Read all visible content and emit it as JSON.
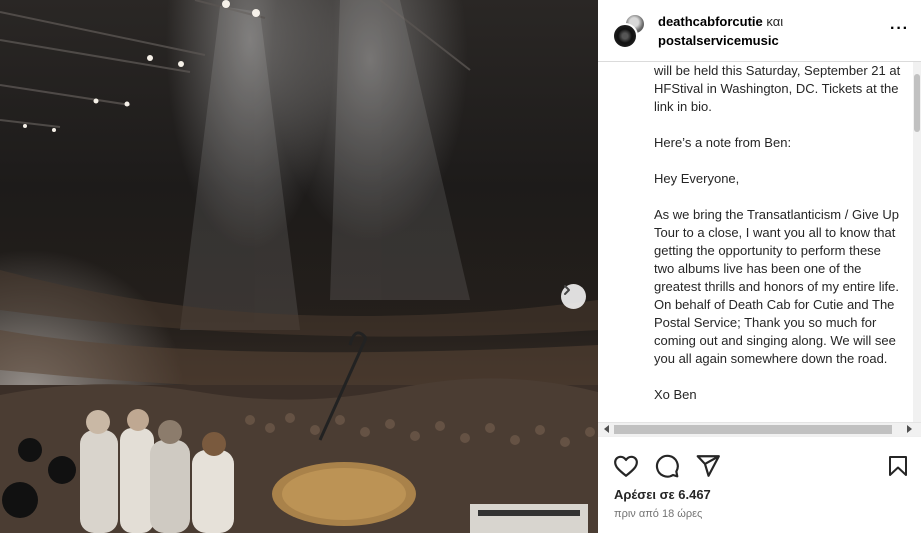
{
  "post": {
    "author_primary": "deathcabforcutie",
    "author_conjunction": "και",
    "author_secondary": "postalservicemusic",
    "caption_paragraphs": [
      "will be held this Saturday, September 21 at HFStival in Washington, DC. Tickets at the link in bio.",
      "Here’s a note from Ben:",
      "Hey Everyone,",
      "As we bring the Transatlanticism / Give Up Tour to a close, I want you all to know that getting the opportunity to perform these two albums live has been one of the greatest thrills and honors of my entire life. On behalf of Death Cab for Cutie and The Postal Service; Thank you so much for coming out and singing along. We will see you all again somewhere down the road.",
      "Xo Ben"
    ],
    "likes_text": "Αρέσει σε 6.467",
    "timestamp_text": "πριν από 18 ώρες"
  },
  "icons": {
    "options": "more-horizontal-icon",
    "next": "chevron-right-icon",
    "like": "heart-icon",
    "comment": "comment-bubble-icon",
    "share": "paper-plane-icon",
    "save": "bookmark-icon"
  },
  "colors": {
    "text_primary": "#262626",
    "text_secondary": "#737373",
    "divider": "#dbdbdb"
  }
}
